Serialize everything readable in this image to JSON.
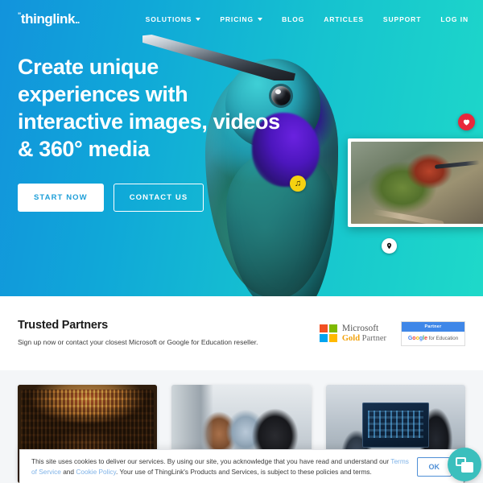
{
  "brand": {
    "logo_text": "thinglink",
    "accent_blue": "#1293dc",
    "accent_teal": "#1ed9c9",
    "chat_teal": "#3bbfbd"
  },
  "nav": {
    "items": [
      {
        "label": "SOLUTIONS",
        "has_dropdown": true
      },
      {
        "label": "PRICING",
        "has_dropdown": true
      },
      {
        "label": "BLOG",
        "has_dropdown": false
      },
      {
        "label": "ARTICLES",
        "has_dropdown": false
      },
      {
        "label": "SUPPORT",
        "has_dropdown": false
      },
      {
        "label": "LOG IN",
        "has_dropdown": false
      }
    ]
  },
  "hero": {
    "headline": "Create unique experiences with interactive images, videos & 360° media",
    "primary_cta": "START NOW",
    "secondary_cta": "CONTACT US",
    "tags": {
      "music_icon": "music-note-icon",
      "pin_icon": "location-pin-icon",
      "heart_icon": "heart-icon"
    }
  },
  "partners": {
    "title": "Trusted Partners",
    "subtitle": "Sign up now or contact your closest Microsoft or Google for Education reseller.",
    "microsoft": {
      "line1": "Microsoft",
      "gold": "Gold",
      "partner": " Partner"
    },
    "google": {
      "top_label": "Partner",
      "brand": "Google",
      "suffix": " for Education"
    }
  },
  "cards": [
    {
      "name": "library-card",
      "image": "library-interior-photo"
    },
    {
      "name": "office-card",
      "image": "colleagues-at-computer-photo"
    },
    {
      "name": "meeting-card",
      "image": "business-presentation-photo"
    }
  ],
  "cookie": {
    "text_1": "This site uses cookies to deliver our services. By using our site, you acknowledge that you have read and understand our ",
    "link_terms": "Terms of Service",
    "text_2": " and ",
    "link_cookie": "Cookie Policy",
    "text_3": ". Your use of ThingLink's Products and Services, is subject to these policies and terms.",
    "ok_label": "OK"
  }
}
